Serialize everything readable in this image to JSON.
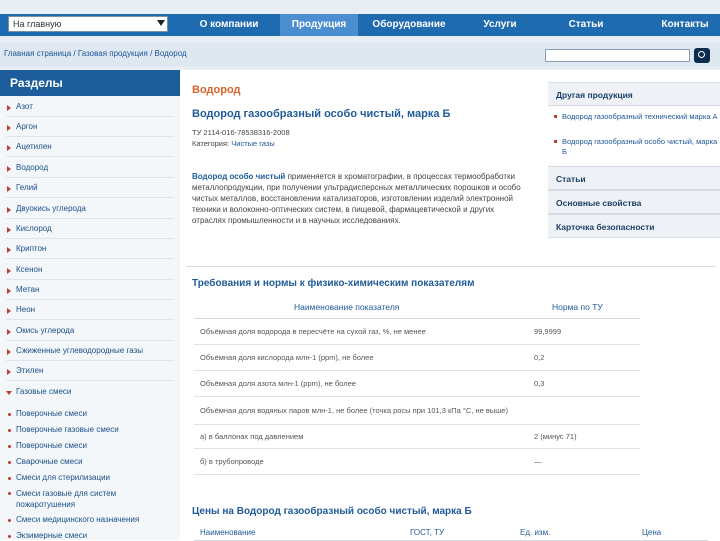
{
  "header": {
    "select_value": "На главную",
    "nav": [
      "О компании",
      "Продукция",
      "Оборудование",
      "Услуги",
      "Статьи",
      "Контакты"
    ],
    "active_index": 1
  },
  "breadcrumb": "Главная страница / Газовая продукция / Водород",
  "sidebar": {
    "title": "Разделы",
    "items": [
      "Азот",
      "Аргон",
      "Ацетилен",
      "Водород",
      "Гелий",
      "Двуокись углерода",
      "Кислород",
      "Криптон",
      "Ксенон",
      "Метан",
      "Неон",
      "Окись углерода",
      "Сжиженные углеводородные газы",
      "Этилен",
      "Газовые смеси"
    ],
    "subitems": [
      "Поверочные смеси",
      "Поверочные газовые смеси",
      "Поверочные смеси",
      "Сварочные смеси",
      "Смеси для стерилизации",
      "Смеси газовые для систем пожаротушения",
      "Смеси медицинского назначения",
      "Экзимерные смеси"
    ]
  },
  "main": {
    "category_title": "Водород",
    "product_title": "Водород газообразный особо чистый, марка Б",
    "tu": "ТУ 2114-016-78538316-2008",
    "category_label": "Категория:",
    "category_link": "Чистые газы",
    "description_bold": "Водород особо чистый",
    "description_rest": " применяется в хроматографии, в процессах термообработки металлопродукции, при получении ультрадисперсных металлических порошков и особо чистых металлов, восстановлении катализаторов, изготовлении изделий электронной техники и волоконно-оптических систем, в пищевой, фармацевтической и других отраслях промышленности и в научных исследованиях.",
    "requirements_title": "Требования и нормы к физико-химическим показателям",
    "table": {
      "headers": [
        "Наименование показателя",
        "Норма по ТУ"
      ],
      "rows": [
        [
          "Объёмная доля водорода в пересчёте на сухой газ, %, не менее",
          "99,9999"
        ],
        [
          "Объёмная доля кислорода млн-1 (ppm), не более",
          "0,2"
        ],
        [
          "Объёмная доля азота млн-1 (ppm), не более",
          "0,3"
        ],
        [
          "Объёмная доля водяных паров млн-1, не более (точка росы при 101,3 кПа °С, не выше)",
          ""
        ],
        [
          "а) в баллонах под давлением",
          "2 (минус 71)"
        ],
        [
          "б) в трубопроводе",
          "—"
        ]
      ]
    },
    "prices_title": "Цены на Водород газообразный особо чистый, марка Б",
    "prices_headers": [
      "Наименование",
      "ГОСТ, ТУ",
      "Ед. изм.",
      "Цена"
    ]
  },
  "right_panel": {
    "other_title": "Другая продукция",
    "links": [
      "Водород газообразный технический марка А",
      "Водород газообразный особо чистый, марка Б"
    ],
    "sections": [
      "Статьи",
      "Основные свойства",
      "Карточка безопасности"
    ]
  }
}
